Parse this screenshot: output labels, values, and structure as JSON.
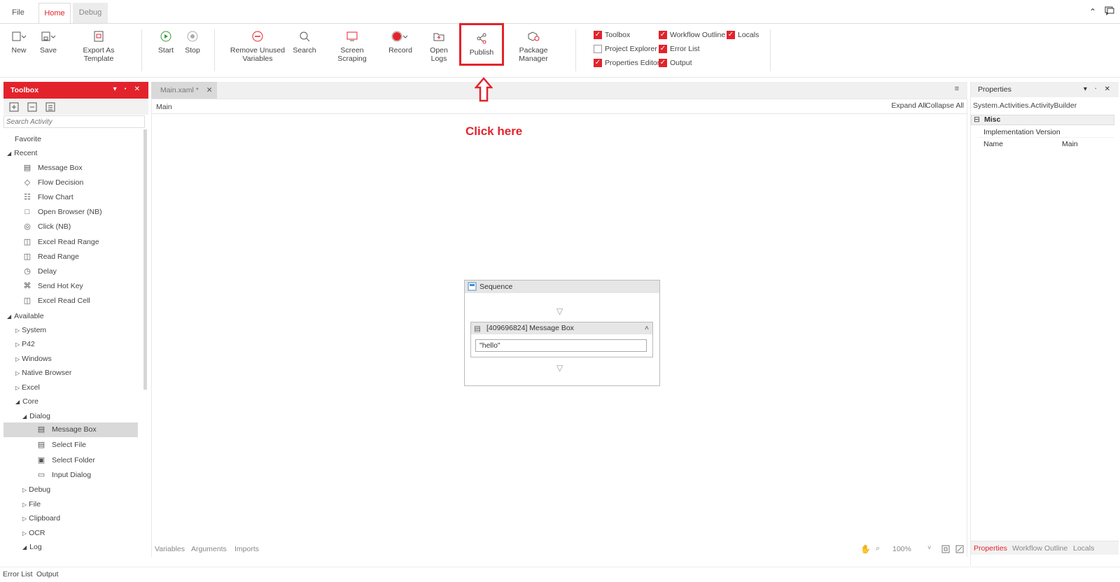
{
  "tabs": {
    "file": "File",
    "home": "Home",
    "debug": "Debug"
  },
  "ribbon": {
    "new": "New",
    "save": "Save",
    "export_template": "Export As Template",
    "start": "Start",
    "stop": "Stop",
    "remove_unused_1": "Remove Unused",
    "remove_unused_2": "Variables",
    "search": "Search",
    "screen_scraping": "Screen Scraping",
    "record": "Record",
    "open_logs": "Open Logs",
    "publish": "Publish",
    "package_manager": "Package Manager"
  },
  "panels": {
    "toolbox": "Toolbox",
    "workflow_outline": "Workflow Outline",
    "locals": "Locals",
    "project_explorer": "Project Explorer",
    "error_list": "Error List",
    "properties_editor": "Properties Editor",
    "output": "Output"
  },
  "panel_checks": {
    "toolbox": true,
    "workflow_outline": true,
    "locals": true,
    "project_explorer": false,
    "error_list": true,
    "properties_editor": true,
    "output": true
  },
  "annotation": {
    "click_here": "Click here"
  },
  "toolbox": {
    "title": "Toolbox",
    "search_placeholder": "Search Activity",
    "favorite": "Favorite",
    "recent": "Recent",
    "recent_items": [
      "Message Box",
      "Flow Decision",
      "Flow Chart",
      "Open Browser (NB)",
      "Click (NB)",
      "Excel Read Range",
      "Read Range",
      "Delay",
      "Send Hot Key",
      "Excel Read Cell"
    ],
    "available": "Available",
    "groups": [
      "System",
      "P42",
      "Windows",
      "Native Browser",
      "Excel"
    ],
    "core": "Core",
    "dialog": "Dialog",
    "dialog_items": [
      "Message Box",
      "Select File",
      "Select Folder",
      "Input Dialog"
    ],
    "core_groups": [
      "Debug",
      "File",
      "Clipboard",
      "OCR"
    ],
    "log": "Log"
  },
  "document": {
    "tab": "Main.xaml *",
    "breadcrumb": "Main",
    "expand_all": "Expand All",
    "collapse_all": "Collapse All",
    "sequence_title": "Sequence",
    "message_box_title": "[409696824] Message Box",
    "message_value": "\"hello\"",
    "bottom_tabs": [
      "Variables",
      "Arguments",
      "Imports"
    ],
    "zoom": "100%"
  },
  "properties": {
    "title": "Properties",
    "type": "System.Activities.ActivityBuilder",
    "category": "Misc",
    "rows": [
      {
        "name": "Implementation Version",
        "value": ""
      },
      {
        "name": "Name",
        "value": "Main"
      }
    ],
    "bottom_tabs": [
      "Properties",
      "Workflow Outline",
      "Locals"
    ]
  },
  "status": {
    "error_list": "Error List",
    "output": "Output"
  },
  "colors": {
    "accent": "#e3232c"
  }
}
